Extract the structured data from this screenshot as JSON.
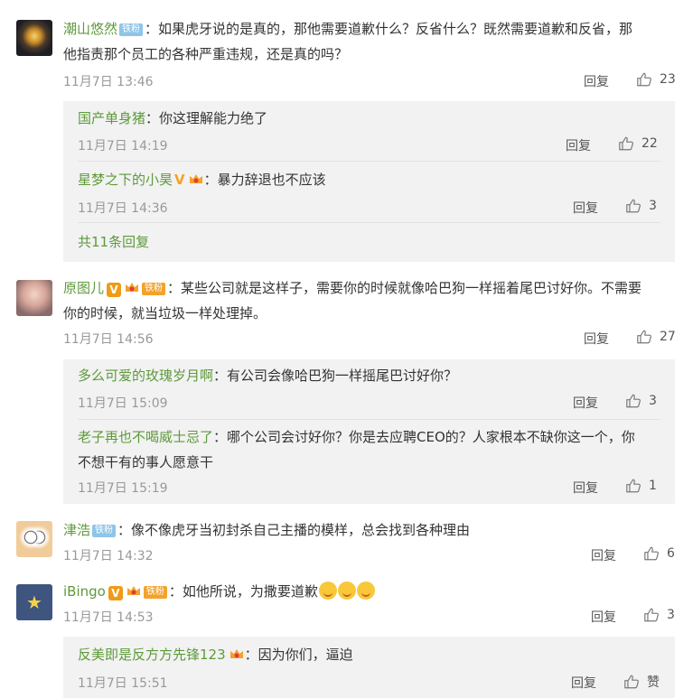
{
  "comments": [
    {
      "user": "潮山悠然",
      "badge": "铁粉",
      "text_line1": "：如果虎牙说的是真的，那他需要道歉什么？反省什么？既然需要道歉和反省，那",
      "text_line2": "他指责那个员工的各种严重违规，还是真的吗？",
      "time": "11月7日 13:46",
      "reply_label": "回复",
      "likes": "23",
      "replies": [
        {
          "user": "国产单身猪",
          "text": "：你这理解能力绝了",
          "time": "11月7日 14:19",
          "reply_label": "回复",
          "likes": "22"
        },
        {
          "user": "星梦之下的小昊",
          "text": "：暴力辞退也不应该",
          "time": "11月7日 14:36",
          "reply_label": "回复",
          "likes": "3"
        }
      ],
      "more_label": "共11条回复"
    },
    {
      "user": "原图儿",
      "badge": "铁粉",
      "text_line1": "：某些公司就是这样子，需要你的时候就像哈巴狗一样摇着尾巴讨好你。不需要",
      "text_line2": "你的时候，就当垃圾一样处理掉。",
      "time": "11月7日 14:56",
      "reply_label": "回复",
      "likes": "27",
      "replies": [
        {
          "user": "多么可爱的玫瑰岁月啊",
          "text": "：有公司会像哈巴狗一样摇尾巴讨好你？",
          "time": "11月7日 15:09",
          "reply_label": "回复",
          "likes": "3"
        },
        {
          "user": "老子再也不喝威士忌了",
          "text_line1": "：哪个公司会讨好你？你是去应聘CEO的？人家根本不缺你这一个，你",
          "text_line2": "不想干有的事人愿意干",
          "time": "11月7日 15:19",
          "reply_label": "回复",
          "likes": "1"
        }
      ]
    },
    {
      "user": "津浩",
      "badge": "铁粉",
      "text": "：像不像虎牙当初封杀自己主播的模样，总会找到各种理由",
      "time": "11月7日 14:32",
      "reply_label": "回复",
      "likes": "6"
    },
    {
      "user": "iBingo",
      "badge": "铁粉",
      "text": "：如他所说，为撒要道歉",
      "time": "11月7日 14:53",
      "reply_label": "回复",
      "likes": "3",
      "replies": [
        {
          "user": "反美即是反方方先锋123",
          "text": "：因为你们，逼迫",
          "time": "11月7日 15:51",
          "reply_label": "回复",
          "likes": "赞"
        }
      ]
    }
  ],
  "colors": {
    "username": "#5d9a3a",
    "reply_bg": "#f2f2f2",
    "vip": "#f09b16",
    "fan_blue": "#8ec5e8"
  }
}
